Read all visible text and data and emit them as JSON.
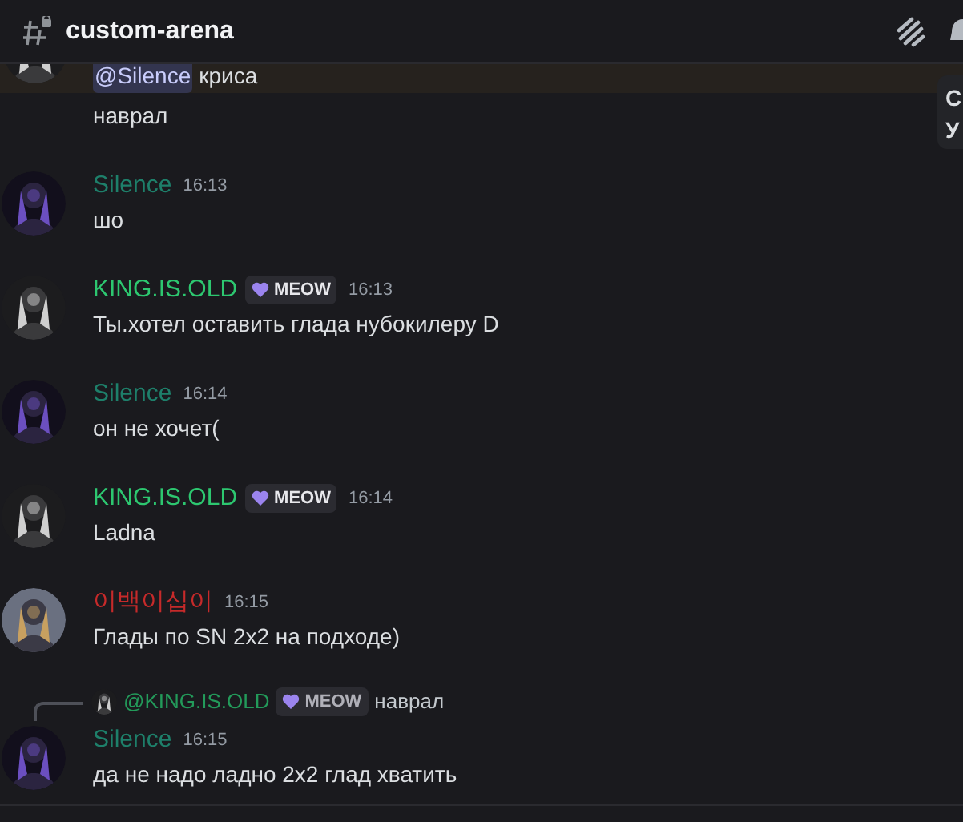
{
  "header": {
    "channel": "custom-arena"
  },
  "messages": [
    {
      "kind": "partial",
      "mention": "@Silence",
      "text": "криса",
      "highlighted": true
    },
    {
      "kind": "followup",
      "text": "наврал",
      "highlighted": false
    },
    {
      "kind": "message",
      "author": "Silence",
      "color": "#1e7f6a",
      "time": "16:13",
      "text": "шо"
    },
    {
      "kind": "message",
      "author": "KING.IS.OLD",
      "color": "#2dc770",
      "tag": "MEOW",
      "time": "16:13",
      "text": "Ты.хотел оставить глада нубокилеру D"
    },
    {
      "kind": "message",
      "author": "Silence",
      "color": "#1e7f6a",
      "time": "16:14",
      "text": "он не хочет("
    },
    {
      "kind": "message",
      "author": "KING.IS.OLD",
      "color": "#2dc770",
      "tag": "MEOW",
      "time": "16:14",
      "text": "Ladna"
    },
    {
      "kind": "message",
      "author": "이백이십이",
      "color": "#c62a2a",
      "time": "16:15",
      "text": "Глады по SN 2x2 на подходе)"
    },
    {
      "kind": "message",
      "reply": {
        "author": "@KING.IS.OLD",
        "color": "#239a5a",
        "tag": "MEOW",
        "text": "наврал"
      },
      "author": "Silence",
      "color": "#1e7f6a",
      "time": "16:15",
      "text": "да не надо ладно 2x2 глад хватить"
    }
  ],
  "tooltip": {
    "lines": [
      "С",
      "У"
    ]
  }
}
